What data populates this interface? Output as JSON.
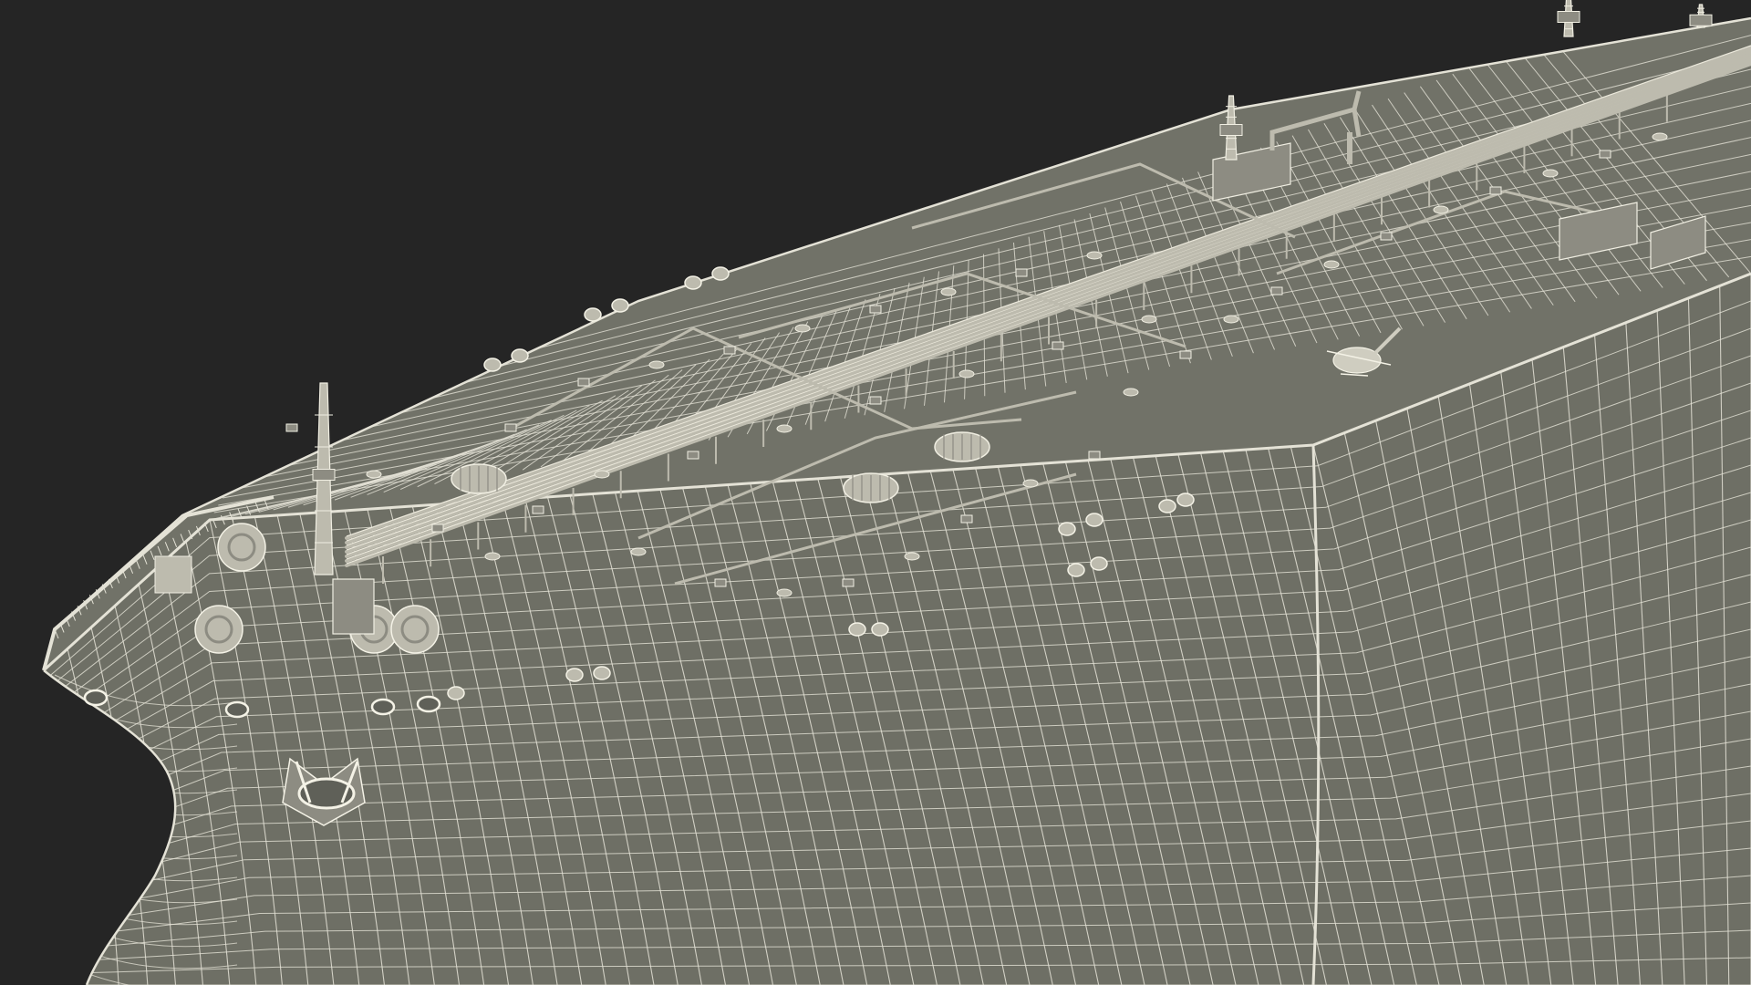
{
  "scene": {
    "subject": "tanker-ship-wireframe",
    "colors": {
      "background": "#252525",
      "hull": "#6e6f65",
      "hull_dark": "#5f6058",
      "deck": "#717268",
      "wire": "#e4e2d6",
      "wire_faint": "#c9c7ba",
      "equipment": "#bdbbae",
      "equipment_dark": "#8d8c82"
    },
    "icons": [
      "anchor-icon",
      "helicopter-icon",
      "mast-icon",
      "crane-icon"
    ]
  }
}
